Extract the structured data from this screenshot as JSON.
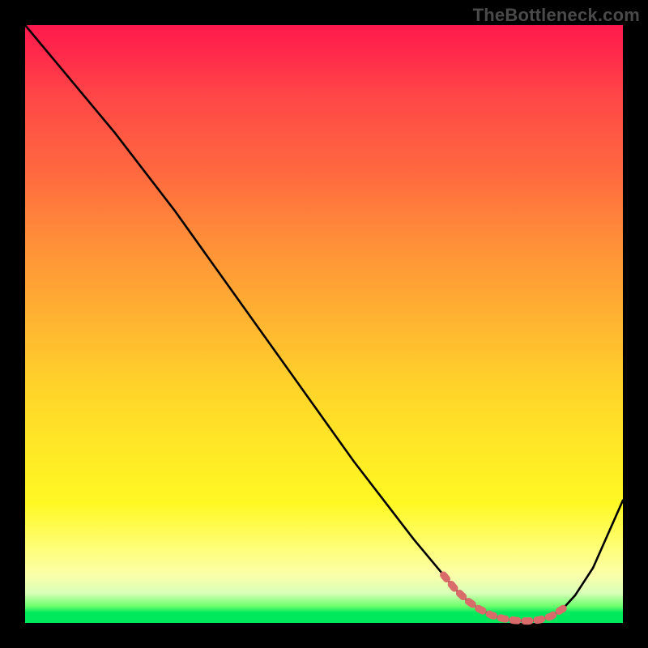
{
  "watermark": "TheBottleneck.com",
  "colors": {
    "background": "#000000",
    "curve": "#000000",
    "highlight": "#d96b6b",
    "gradient_top": "#ff1a4d",
    "gradient_bottom": "#00e85b"
  },
  "chart_data": {
    "type": "line",
    "title": "",
    "xlabel": "",
    "ylabel": "",
    "xlim": [
      0,
      100
    ],
    "ylim": [
      0,
      100
    ],
    "x": [
      0,
      5,
      10,
      15,
      20,
      25,
      30,
      35,
      40,
      45,
      50,
      55,
      60,
      65,
      70,
      72,
      74,
      76,
      78,
      80,
      82,
      84,
      86,
      88,
      90,
      92,
      95,
      100
    ],
    "y": [
      100,
      94,
      88,
      82,
      75.5,
      69,
      62,
      55,
      48,
      41,
      34,
      27,
      20.5,
      14,
      8,
      5.6,
      3.7,
      2.3,
      1.3,
      0.7,
      0.4,
      0.3,
      0.5,
      1.1,
      2.4,
      4.6,
      9.2,
      20.5
    ],
    "series": [
      {
        "name": "curve",
        "x": [
          0,
          5,
          10,
          15,
          20,
          25,
          30,
          35,
          40,
          45,
          50,
          55,
          60,
          65,
          70,
          72,
          74,
          76,
          78,
          80,
          82,
          84,
          86,
          88,
          90,
          92,
          95,
          100
        ],
        "y": [
          100,
          94,
          88,
          82,
          75.5,
          69,
          62,
          55,
          48,
          41,
          34,
          27,
          20.5,
          14,
          8,
          5.6,
          3.7,
          2.3,
          1.3,
          0.7,
          0.4,
          0.3,
          0.5,
          1.1,
          2.4,
          4.6,
          9.2,
          20.5
        ]
      },
      {
        "name": "highlight",
        "x": [
          70,
          72,
          74,
          76,
          78,
          80,
          82,
          84,
          86,
          88,
          90
        ],
        "y": [
          8,
          5.6,
          3.7,
          2.3,
          1.3,
          0.7,
          0.4,
          0.3,
          0.5,
          1.1,
          2.4
        ]
      }
    ]
  }
}
